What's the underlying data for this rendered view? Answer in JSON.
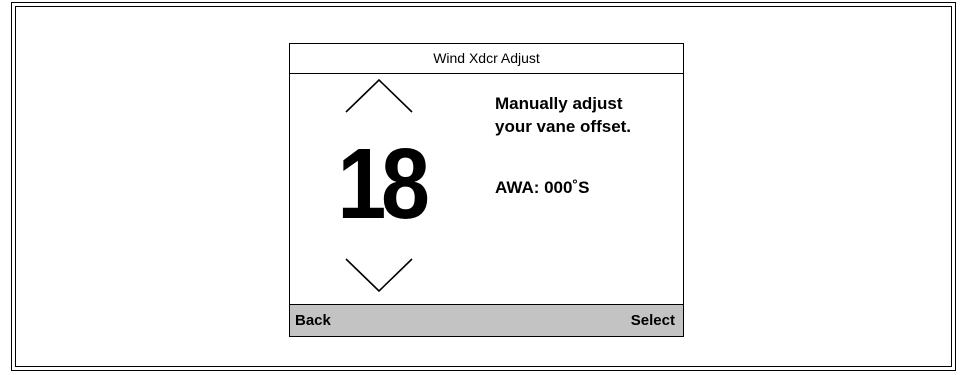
{
  "screen": {
    "title": "Wind Xdcr Adjust",
    "offset_value": "18",
    "instruction_line1": "Manually adjust",
    "instruction_line2": "your vane offset.",
    "awa_readout": "AWA: 000˚S",
    "icons": {
      "up": "chevron-up-icon",
      "down": "chevron-down-icon"
    }
  },
  "softkeys": {
    "left_label": "Back",
    "right_label": "Select"
  },
  "colors": {
    "softkey_bar": "#c3c3c3",
    "border": "#000000",
    "background": "#ffffff"
  }
}
